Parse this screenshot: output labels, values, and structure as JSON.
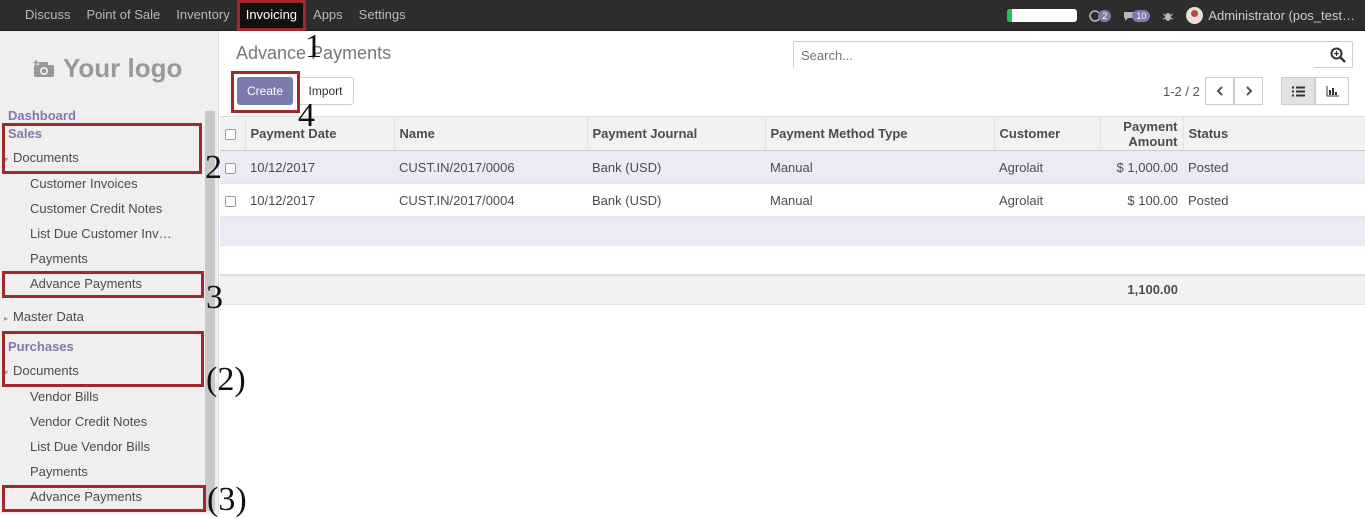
{
  "topbar": {
    "menu": [
      "Discuss",
      "Point of Sale",
      "Inventory",
      "Invoicing",
      "Apps",
      "Settings"
    ],
    "active": "Invoicing",
    "progress": 0.07,
    "chat_count": "2",
    "messages_count": "10",
    "user": "Administrator (pos_test…"
  },
  "sidebar": {
    "logo": "Your logo",
    "dashboard": "Dashboard",
    "sales": "Sales",
    "sales_documents": "Documents",
    "sales_items": [
      "Customer Invoices",
      "Customer Credit Notes",
      "List Due Customer Inv…",
      "Payments",
      "Advance Payments"
    ],
    "master_data": "Master Data",
    "purchases": "Purchases",
    "purchases_documents": "Documents",
    "purchase_items": [
      "Vendor Bills",
      "Vendor Credit Notes",
      "List Due Vendor Bills",
      "Payments",
      "Advance Payments"
    ]
  },
  "main": {
    "breadcrumb": "Advance Payments",
    "search_placeholder": "Search...",
    "create_label": "Create",
    "import_label": "Import",
    "pager": "1-2 / 2"
  },
  "table": {
    "columns": [
      "Payment Date",
      "Name",
      "Payment Journal",
      "Payment Method Type",
      "Customer",
      "Payment Amount",
      "Status"
    ],
    "rows": [
      [
        "10/12/2017",
        "CUST.IN/2017/0006",
        "Bank (USD)",
        "Manual",
        "Agrolait",
        "$ 1,000.00",
        "Posted"
      ],
      [
        "10/12/2017",
        "CUST.IN/2017/0004",
        "Bank (USD)",
        "Manual",
        "Agrolait",
        "$ 100.00",
        "Posted"
      ]
    ],
    "total": "1,100.00"
  },
  "annotations": {
    "a1": "1",
    "a2": "2",
    "a3": "3",
    "a4": "4",
    "b2": "(2)",
    "b3": "(3)"
  }
}
